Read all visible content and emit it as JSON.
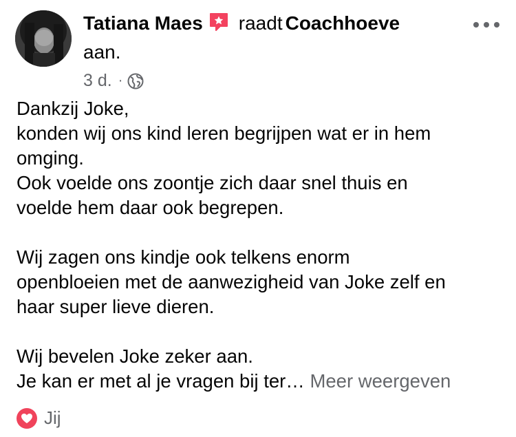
{
  "post": {
    "author": "Tatiana Maes",
    "verb": "raadt",
    "page_name": "Coachhoeve",
    "verb_suffix": "aan.",
    "timestamp": "3 d.",
    "separator": "·",
    "privacy_icon": "globe-icon",
    "recommend_icon": "recommend-star-icon",
    "more_icon": "more-horizontal-icon",
    "body_lines": {
      "l1": "Dankzij Joke,",
      "l2": "konden wij ons kind leren begrijpen wat er in hem",
      "l3": "omging.",
      "l4": "Ook voelde ons zoontje zich daar snel thuis en",
      "l5": "voelde hem daar ook begrepen.",
      "l6": "Wij zagen ons kindje ook telkens enorm",
      "l7": "openbloeien met de aanwezigheid van Joke zelf en",
      "l8": "haar super lieve dieren.",
      "l9": "Wij bevelen Joke zeker aan.",
      "l10": "Je kan er met al je vragen bij ter…"
    },
    "see_more_label": "Meer weergeven",
    "reactions": {
      "icon": "heart-reaction-icon",
      "label": "Jij"
    }
  },
  "colors": {
    "text_primary": "#050505",
    "text_secondary": "#65676b",
    "recommend_pink": "#f3425f",
    "heart_red": "#f0435b"
  }
}
